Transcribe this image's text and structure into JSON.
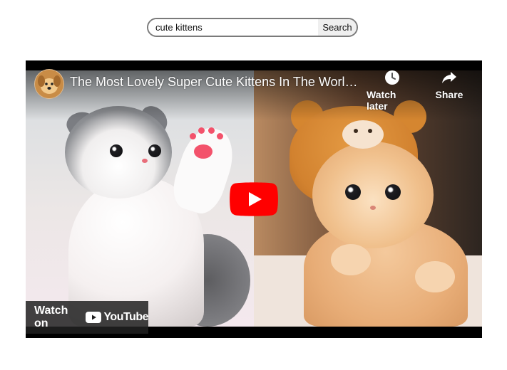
{
  "search": {
    "value": "cute kittens",
    "button_label": "Search"
  },
  "video": {
    "title": "The Most Lovely Super Cute Kittens In The World ...",
    "watch_later_label": "Watch later",
    "share_label": "Share",
    "watch_on_label": "Watch on",
    "youtube_wordmark": "YouTube",
    "play_button_color": "#ff0000"
  }
}
